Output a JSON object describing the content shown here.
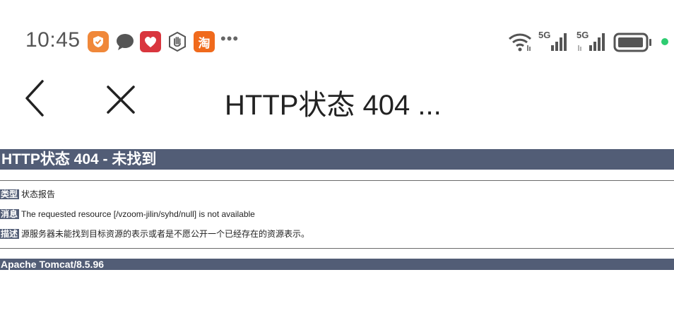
{
  "status_bar": {
    "time": "10:45",
    "more": "•••",
    "notif_taobao": "淘",
    "net1": "5G",
    "net2": "5G"
  },
  "nav": {
    "title": "HTTP状态 404 ..."
  },
  "page": {
    "heading": "HTTP状态 404 - 未找到",
    "rows": [
      {
        "label": "类型",
        "text": "状态报告"
      },
      {
        "label": "消息",
        "text": "The requested resource [/vzoom-jilin/syhd/null] is not available"
      },
      {
        "label": "描述",
        "text": "源服务器未能找到目标资源的表示或者是不愿公开一个已经存在的资源表示。"
      }
    ],
    "footer": "Apache Tomcat/8.5.96"
  }
}
